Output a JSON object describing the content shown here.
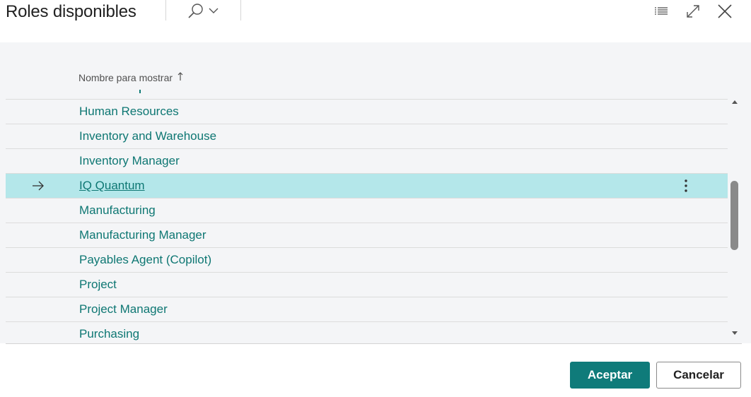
{
  "dialog": {
    "title": "Roles disponibles",
    "header_icons": [
      "search-icon",
      "chevron-down-icon",
      "list-view-icon",
      "expand-icon",
      "close-icon"
    ]
  },
  "grid": {
    "column_header": "Nombre para mostrar",
    "sort_indicator": "↑",
    "rows": [
      {
        "label": "Human Resources",
        "selected": false
      },
      {
        "label": "Inventory and Warehouse",
        "selected": false
      },
      {
        "label": "Inventory Manager",
        "selected": false
      },
      {
        "label": "IQ Quantum",
        "selected": true
      },
      {
        "label": "Manufacturing",
        "selected": false
      },
      {
        "label": "Manufacturing Manager",
        "selected": false
      },
      {
        "label": "Payables Agent (Copilot)",
        "selected": false
      },
      {
        "label": "Project",
        "selected": false
      },
      {
        "label": "Project Manager",
        "selected": false
      },
      {
        "label": "Purchasing",
        "selected": false
      }
    ]
  },
  "footer": {
    "ok_label": "Aceptar",
    "cancel_label": "Cancelar"
  },
  "colors": {
    "accent": "#0f7b7a",
    "link": "#0e7773",
    "selected_row": "#b4e7ea",
    "grid_background": "#f4f5f7"
  }
}
